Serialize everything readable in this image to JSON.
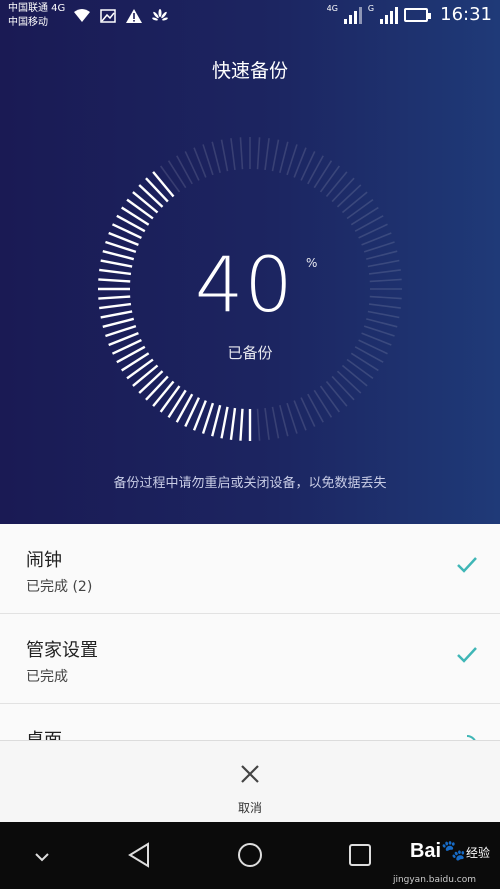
{
  "status_bar": {
    "carrier_line1": "中国联通 4G",
    "carrier_line2": "中国移动",
    "net1": "4G",
    "net2": "G",
    "time": "16:31"
  },
  "backup": {
    "title": "快速备份",
    "percent": "40",
    "percent_sign": "%",
    "progress": 0.4,
    "status_label": "已备份",
    "hint": "备份过程中请勿重启或关闭设备，以免数据丢失"
  },
  "items": [
    {
      "name": "闹钟",
      "status": "已完成 (2)",
      "done": true
    },
    {
      "name": "管家设置",
      "status": "已完成",
      "done": true
    },
    {
      "name": "桌面",
      "status": "",
      "done": false
    }
  ],
  "cancel": {
    "label": "取消"
  },
  "watermark": {
    "brand": "Bai",
    "brand2": "经验",
    "site": "jingyan.baidu.com"
  },
  "colors": {
    "accent": "#3fb6b6",
    "hero_start": "#1a1a54",
    "hero_end": "#1f3a78"
  }
}
